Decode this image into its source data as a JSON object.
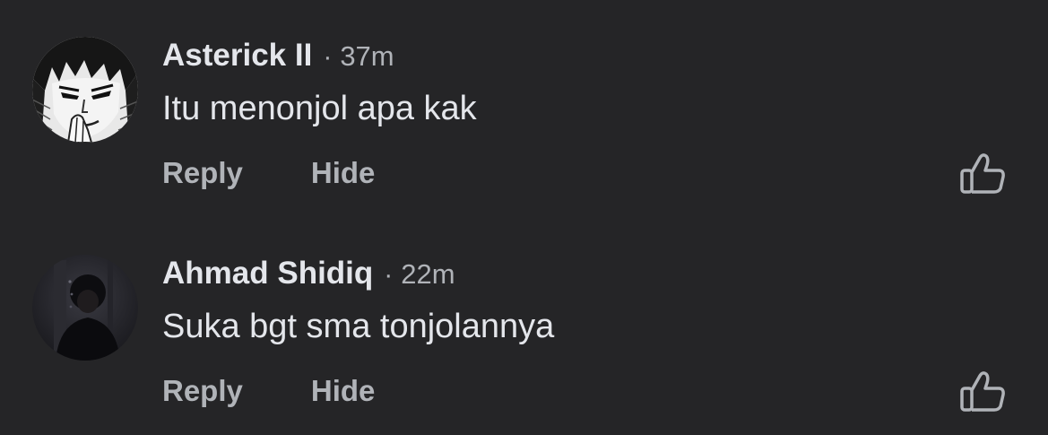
{
  "comments": [
    {
      "author": "Asterick II",
      "separator": "·",
      "time": "37m",
      "text": "Itu menonjol apa kak",
      "actions": {
        "reply": "Reply",
        "hide": "Hide"
      },
      "like_icon": "thumbs-up-icon",
      "avatar": "manga-character-avatar"
    },
    {
      "author": "Ahmad Shidiq",
      "separator": "·",
      "time": "22m",
      "text": "Suka bgt sma tonjolannya",
      "actions": {
        "reply": "Reply",
        "hide": "Hide"
      },
      "like_icon": "thumbs-up-icon",
      "avatar": "dark-photo-avatar"
    }
  ],
  "colors": {
    "background": "#252527",
    "primary_text": "#e4e6eb",
    "secondary_text": "#b0b3b8"
  }
}
